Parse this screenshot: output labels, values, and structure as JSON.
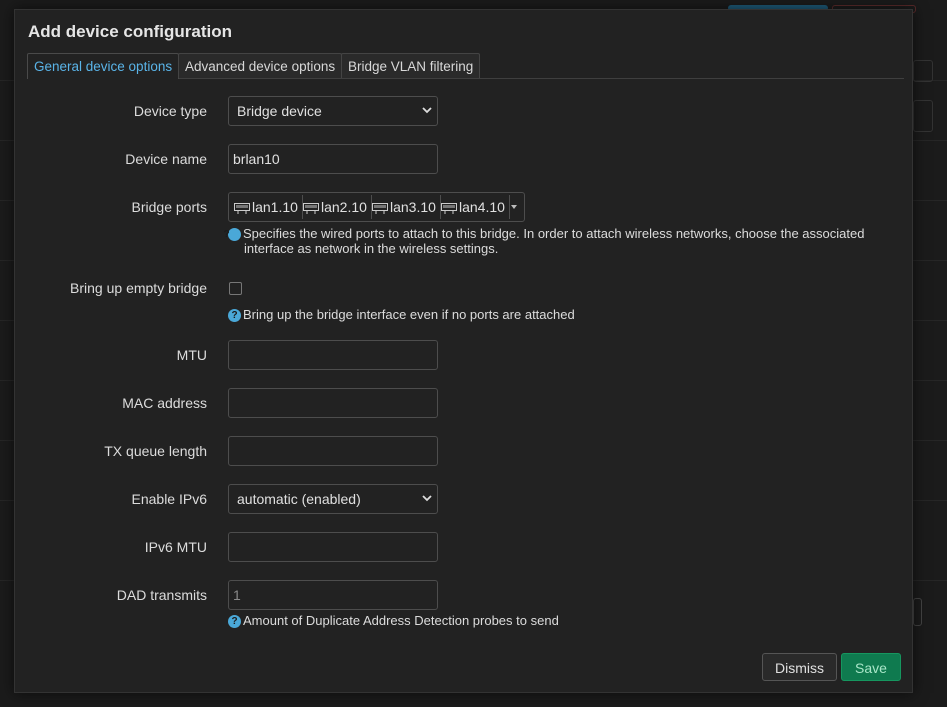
{
  "modal": {
    "title": "Add device configuration",
    "tabs": [
      {
        "label": "General device options",
        "active": true
      },
      {
        "label": "Advanced device options",
        "active": false
      },
      {
        "label": "Bridge VLAN filtering",
        "active": false
      }
    ]
  },
  "form": {
    "device_type": {
      "label": "Device type",
      "value": "Bridge device"
    },
    "device_name": {
      "label": "Device name",
      "value": "brlan10"
    },
    "bridge_ports": {
      "label": "Bridge ports",
      "ports": [
        "lan1.10",
        "lan2.10",
        "lan3.10",
        "lan4.10"
      ],
      "help": "Specifies the wired ports to attach to this bridge. In order to attach wireless networks, choose the associated interface as network in the wireless settings."
    },
    "bring_up_empty": {
      "label": "Bring up empty bridge",
      "checked": false,
      "help": "Bring up the bridge interface even if no ports are attached"
    },
    "mtu": {
      "label": "MTU",
      "value": ""
    },
    "mac_address": {
      "label": "MAC address",
      "value": ""
    },
    "tx_queue_length": {
      "label": "TX queue length",
      "value": ""
    },
    "enable_ipv6": {
      "label": "Enable IPv6",
      "value": "automatic (enabled)"
    },
    "ipv6_mtu": {
      "label": "IPv6 MTU",
      "value": ""
    },
    "dad_transmits": {
      "label": "DAD transmits",
      "placeholder": "1",
      "help": "Amount of Duplicate Address Detection probes to send"
    }
  },
  "footer": {
    "dismiss_label": "Dismiss",
    "save_label": "Save"
  },
  "colors": {
    "accent": "#5ab4e8",
    "save": "#0f7a4f",
    "help_icon": "#4aa8d8"
  },
  "icons": {
    "help": "question-circle-icon",
    "port": "ethernet-port-icon",
    "select": "chevron-down-icon"
  }
}
